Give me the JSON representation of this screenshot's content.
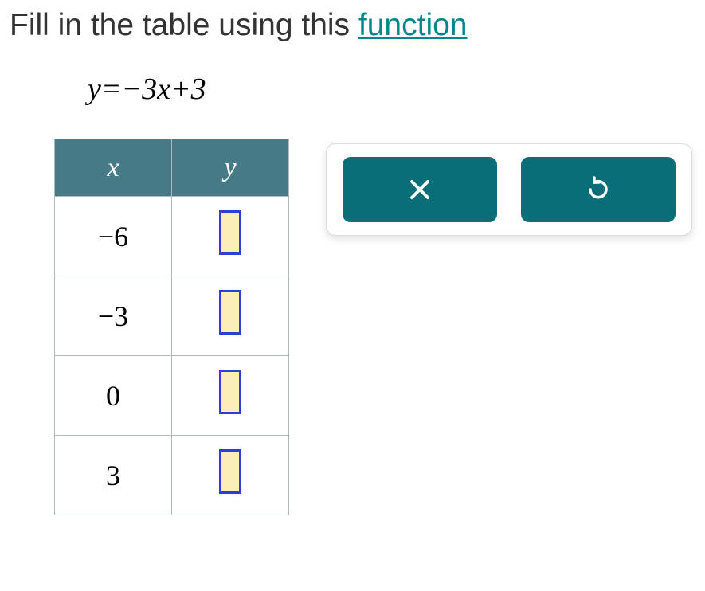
{
  "prompt": {
    "prefix": "Fill in the table using this ",
    "link": "function"
  },
  "equation": "y=−3x+3",
  "table": {
    "header_x": "x",
    "header_y": "y",
    "rows": [
      {
        "x": "−6",
        "y": ""
      },
      {
        "x": "−3",
        "y": ""
      },
      {
        "x": "0",
        "y": ""
      },
      {
        "x": "3",
        "y": ""
      }
    ]
  },
  "icons": {
    "close": "close-icon",
    "undo": "undo-icon"
  },
  "chart_data": {
    "type": "table",
    "title": "Fill in the table using this function",
    "equation": "y = -3x + 3",
    "columns": [
      "x",
      "y"
    ],
    "rows": [
      {
        "x": -6,
        "y": null
      },
      {
        "x": -3,
        "y": null
      },
      {
        "x": 0,
        "y": null
      },
      {
        "x": 3,
        "y": null
      }
    ]
  }
}
